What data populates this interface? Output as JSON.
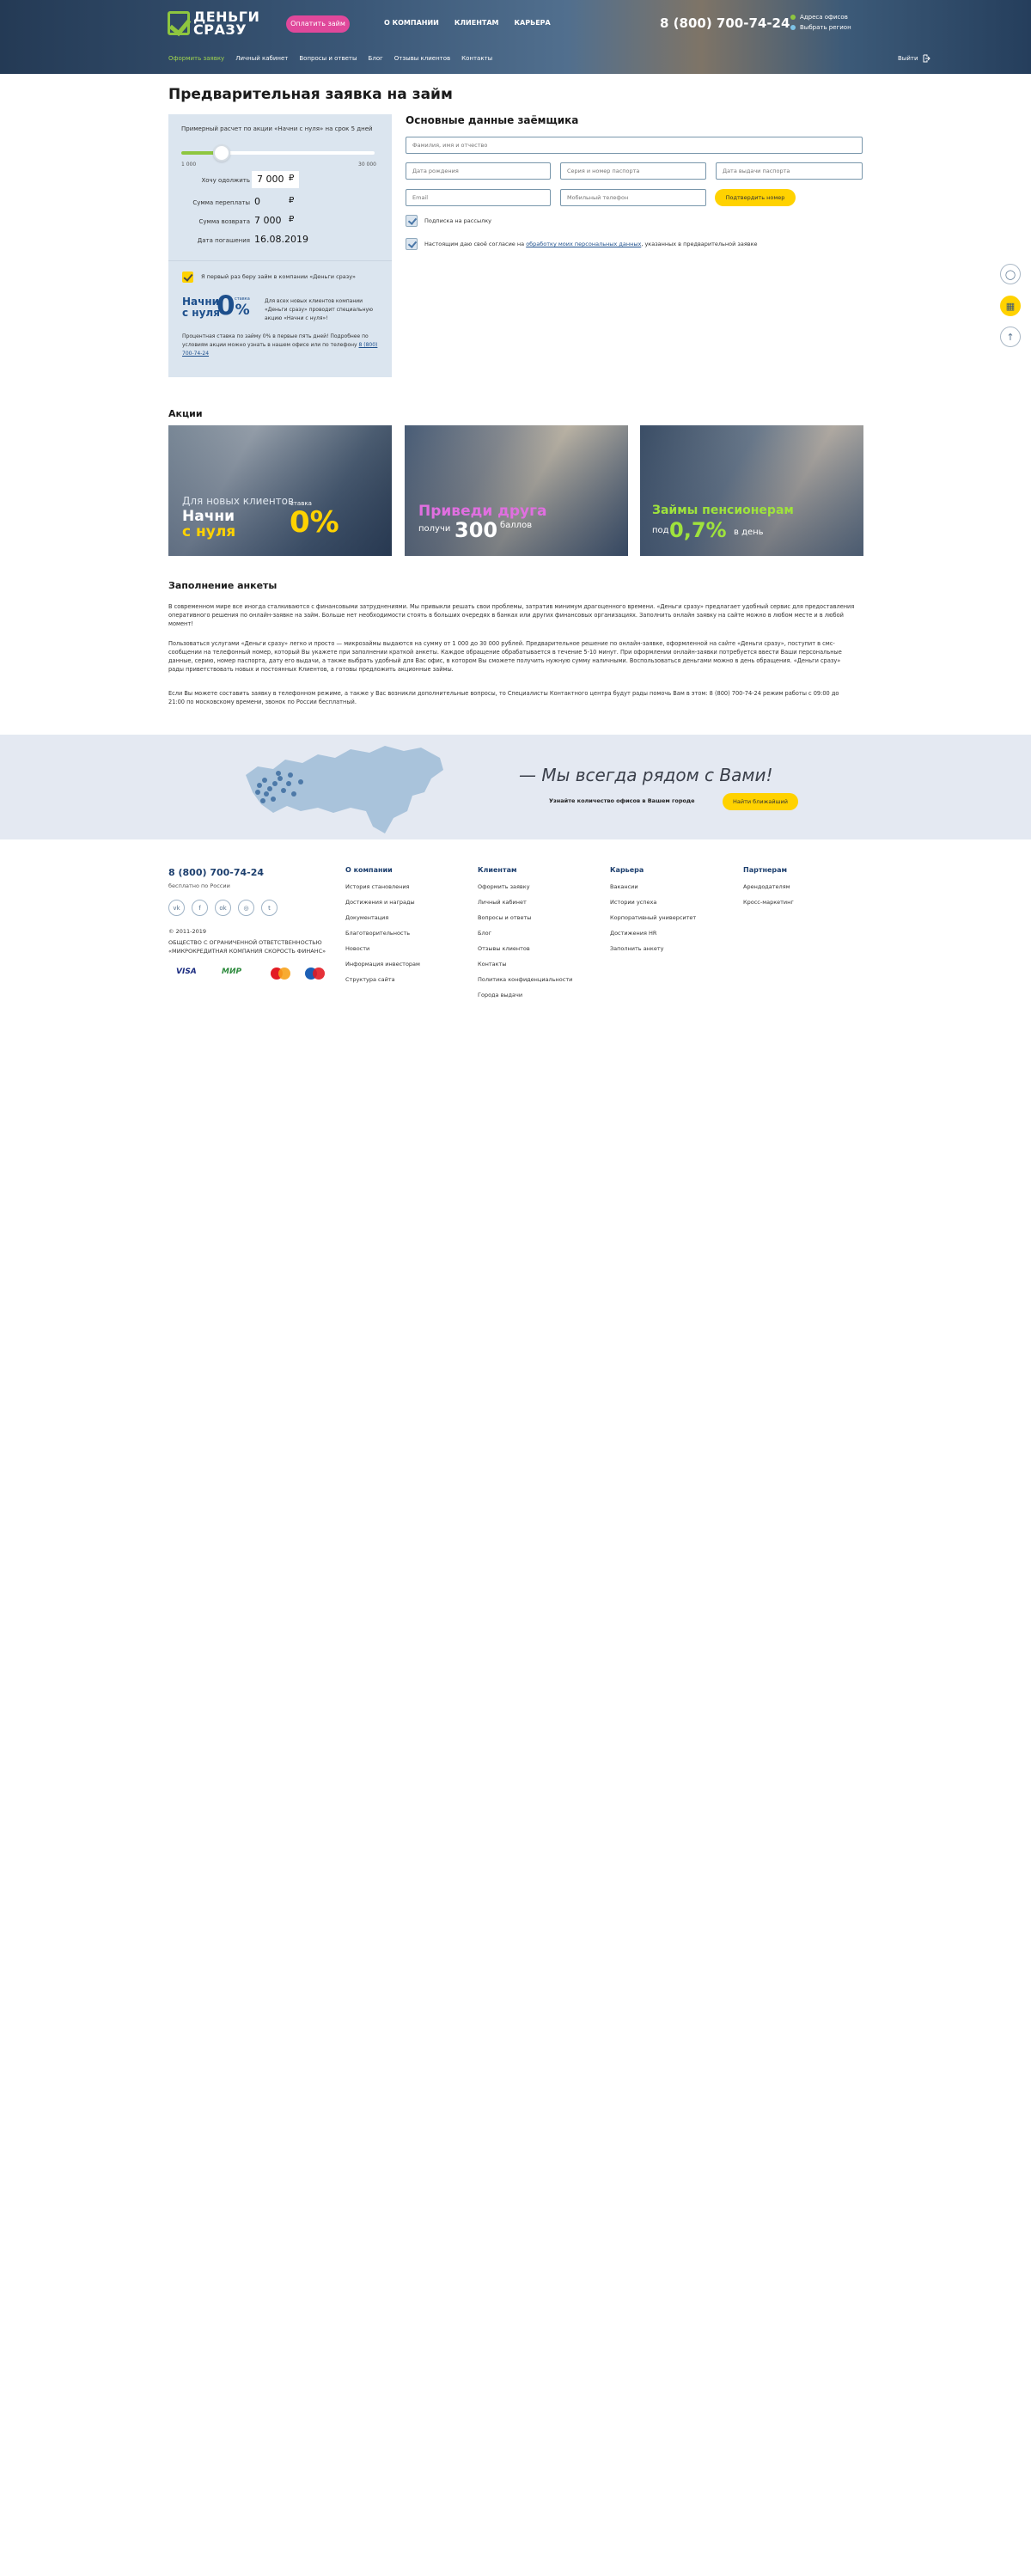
{
  "header": {
    "logo_text": "ДЕНЬГИ СРАЗУ",
    "pay_button": "Оплатить займ",
    "nav": [
      "О КОМПАНИИ",
      "КЛИЕНТАМ",
      "КАРЬЕРА"
    ],
    "phone": "8 (800) 700-74-24",
    "links": [
      "Адреса офисов",
      "Выбрать регион"
    ],
    "subnav": [
      "Оформить заявку",
      "Личный кабинет",
      "Вопросы и ответы",
      "Блог",
      "Отзывы клиентов",
      "Контакты"
    ],
    "subnav_active": "Оформить заявку",
    "logout": "Выйти"
  },
  "page_title": "Предварительная заявка на займ",
  "calculator": {
    "note": "Примерный расчет по акции «Начни с нуля» на срок 5 дней",
    "slider_min": "1 000",
    "slider_max": "30 000",
    "slider_fraction": 0.207,
    "rows": [
      {
        "label": "Хочу одолжить",
        "value": "7 000",
        "currency": "₽"
      },
      {
        "label": "Сумма переплаты",
        "value": "0",
        "currency": "₽"
      },
      {
        "label": "Сумма возврата",
        "value": "7 000",
        "currency": "₽"
      },
      {
        "label": "Дата погашения",
        "value": "16.08.2019",
        "currency": ""
      }
    ],
    "first_time_label": "Я первый раз беру займ в компании «Деньги сразу»",
    "promo_line1": "Начни",
    "promo_line2": "с нуля",
    "promo_zero": "0",
    "promo_percent": "%",
    "promo_small": "ставка",
    "promo_desc": "Для всех новых клиентов компании «Деньги сразу» проводит специальную акцию «Начни с нуля»!",
    "promo_note": "Процентная ставка по займу 0% в первые пять дней! Подробнее по условиям акции можно узнать в нашем офисе или по телефону",
    "promo_phone": "8 (800) 700-74-24"
  },
  "form": {
    "title": "Основные данные заёмщика",
    "placeholders": {
      "fio": "Фамилия, имя и отчество",
      "birthdate": "Дата рождения",
      "passport": "Серия и номер паспорта",
      "issue_date": "Дата выдачи паспорта",
      "email": "Email",
      "mobile": "Мобильный телефон"
    },
    "confirm_button": "Подтвердить номер",
    "subscribe": "Подписка на рассылку",
    "consent_prefix": "Настоящим даю своё согласие на",
    "consent_link": "обработку моих персональных данных",
    "consent_suffix": ", указанных в предварительной заявке"
  },
  "promos": {
    "title": "Акции",
    "banner1": {
      "line1": "Для новых клиентов",
      "line2": "Начни",
      "line3": "с нуля",
      "big": "0%",
      "small": "ставка"
    },
    "banner2": {
      "line1": "Приведи друга",
      "line2": "получи",
      "big": "300",
      "small": "баллов"
    },
    "banner3": {
      "line1": "Займы пенсионерам",
      "small": "под",
      "big": "0,7%",
      "suffix": "в день"
    }
  },
  "questionnaire": {
    "title": "Заполнение анкеты",
    "p1": "В современном мире все иногда сталкиваются с финансовыми затруднениями. Мы привыкли решать свои проблемы, затратив минимум драгоценного времени. «Деньги сразу» предлагает удобный сервис для предоставления оперативного решения по онлайн-заявке на займ. Больше нет необходимости стоять в больших очередях в банках или других финансовых организациях. Заполнить онлайн заявку на сайте можно в любом месте и в любой момент!",
    "p2": "Пользоваться услугами «Деньги сразу» легко и просто — микрозаймы выдаются на сумму от 1 000 до 30 000 рублей. Предварительное решение по онлайн-заявке, оформленной на сайте «Деньги сразу», поступит в смс-сообщении на телефонный номер, который Вы укажете при заполнении краткой анкеты. Каждое обращение обрабатывается в течение 5-10 минут. При оформлении онлайн-заявки потребуется ввести Ваши персональные данные, серию, номер паспорта, дату его выдачи, а также выбрать удобный для Вас офис, в котором Вы сможете получить нужную сумму наличными. Воспользоваться деньгами можно в день обращения. «Деньги сразу» рады приветствовать новых и постоянных Клиентов, а готовы предложить акционные займы.",
    "p3": "Если Вы можете составить заявку в телефонном режиме, а также у Вас возникли дополнительные вопросы, то Специалисты Контактного центра будут рады помочь Вам в этом: 8 (800) 700-74-24 режим работы с 09:00 до 21:00 по московскому времени, звонок по России бесплатный."
  },
  "map_section": {
    "slogan": "Мы всегда рядом с Вами!",
    "sub": "Узнайте количество офисов в Вашем городе",
    "button": "Найти ближайший"
  },
  "footer": {
    "phone": "8 (800) 700-74-24",
    "free": "бесплатно по России",
    "social": [
      "vk-icon",
      "facebook-icon",
      "ok-icon",
      "instagram-icon",
      "twitter-icon"
    ],
    "copyright": "© 2011-2019",
    "org": "ОБЩЕСТВО С ОГРАНИЧЕННОЙ ОТВЕТСТВЕННОСТЬЮ «МИКРОКРЕДИТНАЯ КОМПАНИЯ СКОРОСТЬ ФИНАНС»",
    "payments": [
      "VISA",
      "МИР"
    ],
    "columns": [
      {
        "title": "О компании",
        "items": [
          "История становления",
          "Достижения и награды",
          "Документация",
          "Благотворительность",
          "Новости",
          "Информация инвесторам",
          "Структура сайта"
        ]
      },
      {
        "title": "Клиентам",
        "items": [
          "Оформить заявку",
          "Личный кабинет",
          "Вопросы и ответы",
          "Блог",
          "Отзывы клиентов",
          "Контакты",
          "Политика конфиденциальности",
          "Города выдачи"
        ]
      },
      {
        "title": "Карьера",
        "items": [
          "Вакансии",
          "Истории успеха",
          "Корпоративный университет",
          "Достижения HR",
          "Заполнить анкету"
        ]
      },
      {
        "title": "Партнерам",
        "items": [
          "Арендодателям",
          "Кросс-маркетинг"
        ]
      }
    ]
  },
  "colors": {
    "brand_green": "#8ec63f",
    "accent_pink": "#e0489b",
    "accent_yellow": "#ffd200",
    "navy": "#1d3f6e"
  }
}
